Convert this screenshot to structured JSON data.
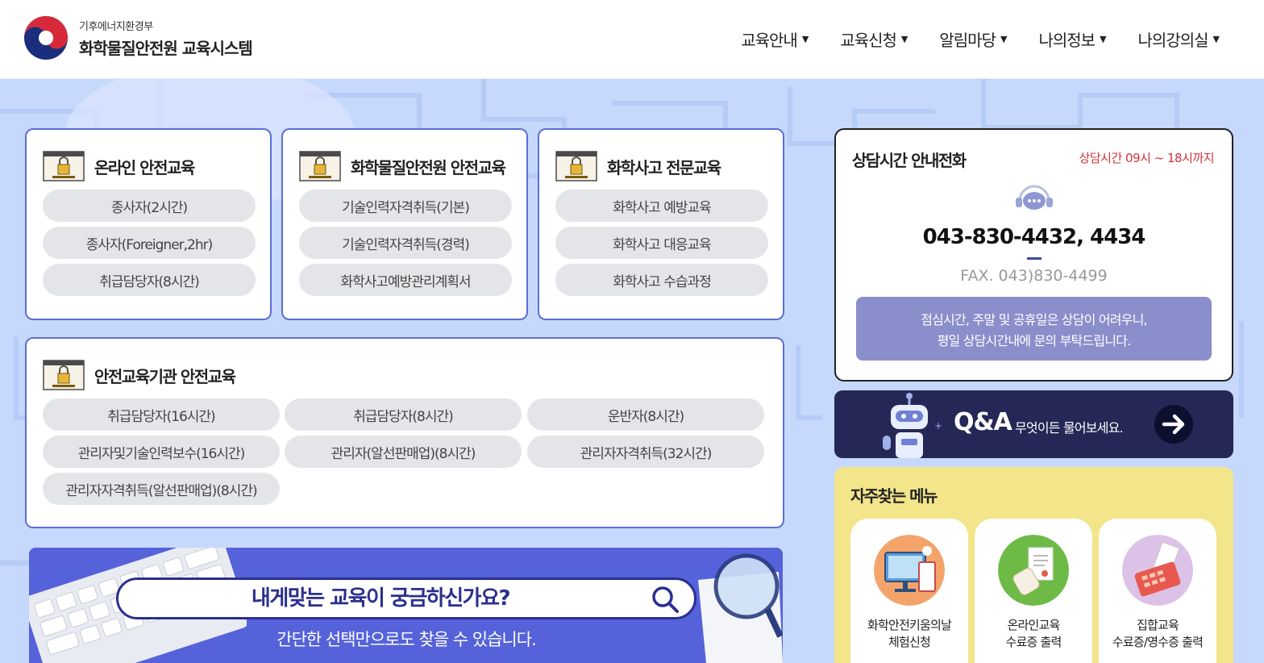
{
  "header": {
    "ministry": "기후에너지환경부",
    "system_name": "화학물질안전원 교육시스템",
    "nav": [
      {
        "label": "교육안내"
      },
      {
        "label": "교육신청"
      },
      {
        "label": "알림마당"
      },
      {
        "label": "나의정보"
      },
      {
        "label": "나의강의실"
      }
    ]
  },
  "cards": {
    "online": {
      "title": "온라인 안전교육",
      "items": [
        "종사자(2시간)",
        "종사자(Foreigner,2hr)",
        "취급담당자(8시간)"
      ]
    },
    "institute": {
      "title": "화학물질안전원 안전교육",
      "items": [
        "기술인력자격취득(기본)",
        "기술인력자격취득(경력)",
        "화학사고예방관리계획서"
      ]
    },
    "accident": {
      "title": "화학사고 전문교육",
      "items": [
        "화학사고 예방교육",
        "화학사고 대응교육",
        "화학사고 수습과정"
      ]
    },
    "agency": {
      "title": "안전교육기관 안전교육",
      "items": [
        "취급담당자(16시간)",
        "취급담당자(8시간)",
        "운반자(8시간)",
        "관리자및기술인력보수(16시간)",
        "관리자(알선판매업)(8시간)",
        "관리자자격취득(32시간)",
        "관리자자격취득(알선판매업)(8시간)"
      ]
    }
  },
  "banner": {
    "search_text": "내게맞는 교육이 궁금하신가요?",
    "subtitle": "간단한 선택만으로도 찾을 수 있습니다."
  },
  "contact": {
    "title": "상담시간 안내전화",
    "hours": "상담시간 09시 ~ 18시까지",
    "phone": "043-830-4432, 4434",
    "fax": "FAX. 043)830-4499",
    "note_line1": "점심시간, 주말 및 공휴일은 상담이 어려우니,",
    "note_line2": "평일 상담시간내에 문의 부탁드립니다."
  },
  "qna": {
    "title": "Q&A",
    "subtitle": "무엇이든 물어보세요."
  },
  "frequent": {
    "title": "자주찾는 메뉴",
    "items": [
      {
        "line1": "화학안전키움의날",
        "line2": "체험신청",
        "icon": "computer-icon",
        "color": "#f4a46a"
      },
      {
        "line1": "온라인교육",
        "line2": "수료증 출력",
        "icon": "certificate-icon",
        "color": "#6dbb46"
      },
      {
        "line1": "집합교육",
        "line2": "수료증/영수증 출력",
        "icon": "receipt-printer-icon",
        "color": "#dcc2e6"
      }
    ]
  },
  "colors": {
    "accent": "#5a6fd6",
    "banner": "#5562d9",
    "qna_bg": "#252856",
    "freq_bg": "#f2e58a",
    "hours_red": "#d0323a"
  }
}
